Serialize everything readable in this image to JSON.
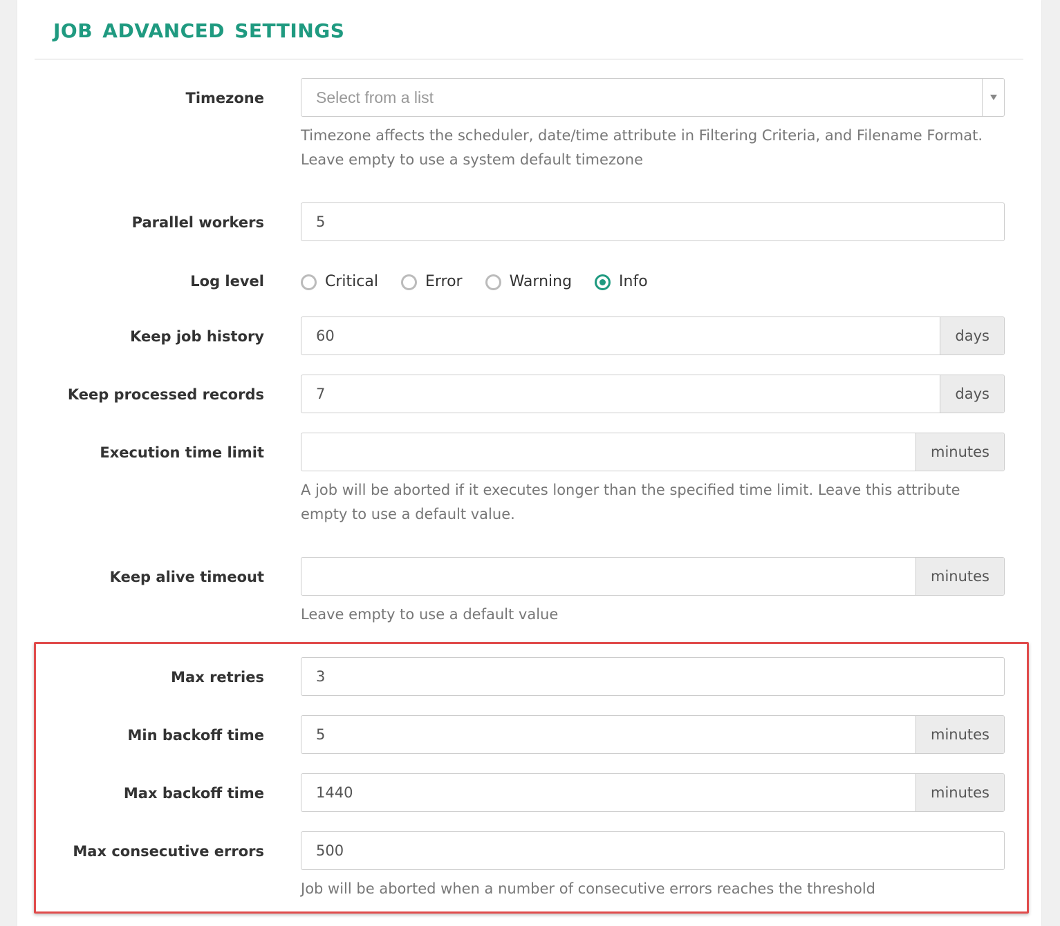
{
  "section": {
    "title": "JOB ADVANCED SETTINGS"
  },
  "colors": {
    "accent": "#1f9a80",
    "highlight_border": "#e04b4b"
  },
  "timezone": {
    "label": "Timezone",
    "placeholder": "Select from a list",
    "caret_icon": "chevron-down-icon",
    "help": [
      "Timezone affects the scheduler, date/time attribute in Filtering Criteria, and Filename Format.",
      "Leave empty to use a system default timezone"
    ]
  },
  "parallel_workers": {
    "label": "Parallel workers",
    "value": "5"
  },
  "log_level": {
    "label": "Log level",
    "options": [
      {
        "label": "Critical",
        "checked": false
      },
      {
        "label": "Error",
        "checked": false
      },
      {
        "label": "Warning",
        "checked": false
      },
      {
        "label": "Info",
        "checked": true
      }
    ]
  },
  "keep_job_history": {
    "label": "Keep job history",
    "value": "60",
    "unit": "days"
  },
  "keep_processed_records": {
    "label": "Keep processed records",
    "value": "7",
    "unit": "days"
  },
  "execution_time_limit": {
    "label": "Execution time limit",
    "value": "",
    "unit": "minutes",
    "help": [
      "A job will be aborted if it executes longer than the specified time limit. Leave this attribute",
      "empty to use a default value."
    ]
  },
  "keep_alive_timeout": {
    "label": "Keep alive timeout",
    "value": "",
    "unit": "minutes",
    "help": "Leave empty to use a default value"
  },
  "max_retries": {
    "label": "Max retries",
    "value": "3"
  },
  "min_backoff_time": {
    "label": "Min backoff time",
    "value": "5",
    "unit": "minutes"
  },
  "max_backoff_time": {
    "label": "Max backoff time",
    "value": "1440",
    "unit": "minutes"
  },
  "max_consecutive_errors": {
    "label": "Max consecutive errors",
    "value": "500",
    "help": "Job will be aborted when a number of consecutive errors reaches the threshold"
  }
}
